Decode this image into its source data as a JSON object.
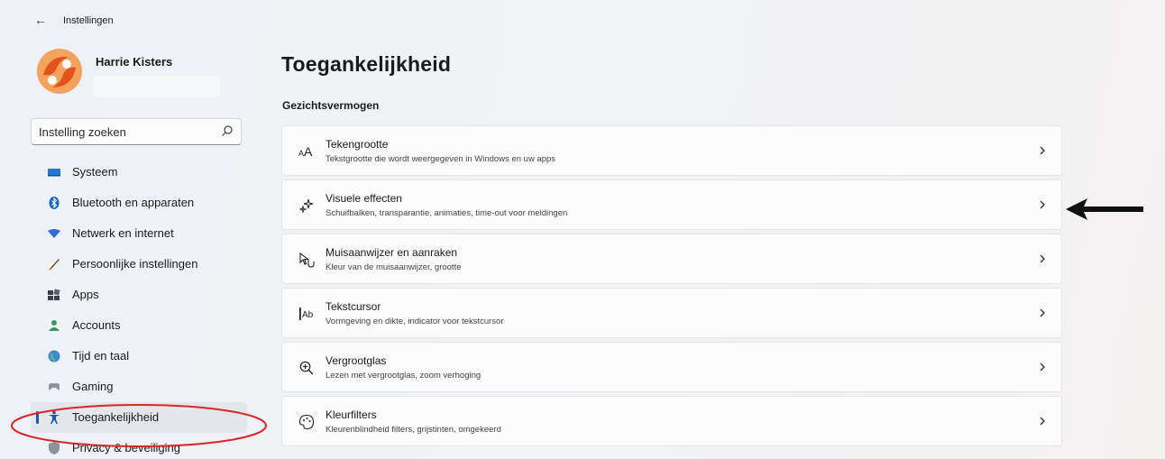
{
  "window": {
    "title": "Instellingen"
  },
  "user": {
    "name": "Harrie Kisters"
  },
  "search": {
    "placeholder": "Instelling zoeken"
  },
  "sidebar": {
    "items": [
      {
        "label": "Systeem",
        "icon": "monitor-icon",
        "selected": false
      },
      {
        "label": "Bluetooth en apparaten",
        "icon": "bluetooth-icon",
        "selected": false
      },
      {
        "label": "Netwerk en internet",
        "icon": "wifi-icon",
        "selected": false
      },
      {
        "label": "Persoonlijke instellingen",
        "icon": "brush-icon",
        "selected": false
      },
      {
        "label": "Apps",
        "icon": "apps-icon",
        "selected": false
      },
      {
        "label": "Accounts",
        "icon": "person-icon",
        "selected": false
      },
      {
        "label": "Tijd en taal",
        "icon": "globe-clock-icon",
        "selected": false
      },
      {
        "label": "Gaming",
        "icon": "gamepad-icon",
        "selected": false
      },
      {
        "label": "Toegankelijkheid",
        "icon": "accessibility-icon",
        "selected": true
      },
      {
        "label": "Privacy & beveiliging",
        "icon": "shield-icon",
        "selected": false
      }
    ]
  },
  "main": {
    "title": "Toegankelijkheid",
    "section": "Gezichtsvermogen",
    "cards": [
      {
        "title": "Tekengrootte",
        "description": "Tekstgrootte die wordt weergegeven in Windows en uw apps",
        "icon": "text-size-icon"
      },
      {
        "title": "Visuele effecten",
        "description": "Schuifbalken, transparantie, animaties, time-out voor meldingen",
        "icon": "sparkle-icon"
      },
      {
        "title": "Muisaanwijzer en aanraken",
        "description": "Kleur van de muisaanwijzer, grootte",
        "icon": "pointer-touch-icon"
      },
      {
        "title": "Tekstcursor",
        "description": "Vormgeving en dikte, indicator voor tekstcursor",
        "icon": "text-cursor-icon"
      },
      {
        "title": "Vergrootglas",
        "description": "Lezen met vergrootglas, zoom verhoging",
        "icon": "magnifier-icon"
      },
      {
        "title": "Kleurfilters",
        "description": "Kleurenblindheid filters, grijstinten, omgekeerd",
        "icon": "color-filter-icon"
      }
    ]
  },
  "colors": {
    "accent": "#1b56a0",
    "annotation_circle": "#d8262a",
    "annotation_arrow": "#111111"
  }
}
